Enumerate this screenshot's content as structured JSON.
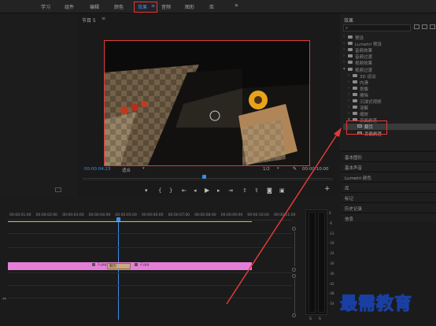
{
  "workspace_tabs": [
    "学习",
    "组件",
    "编辑",
    "颜色",
    "效果",
    "音频",
    "图形",
    "库"
  ],
  "workspace_menu_icon": "chevron-double-right-icon",
  "monitor": {
    "title": "节目 5",
    "timecode_left": "00:00:04:23",
    "fit_label": "适合",
    "quality": "1/2",
    "timecode_right": "00:00:10:00"
  },
  "effects_panel": {
    "title": "效果",
    "tree": [
      {
        "label": "预设",
        "level": 0,
        "open": false
      },
      {
        "label": "Lumetri 预设",
        "level": 0,
        "open": false
      },
      {
        "label": "音频效果",
        "level": 0,
        "open": false
      },
      {
        "label": "音频过渡",
        "level": 0,
        "open": false
      },
      {
        "label": "视频效果",
        "level": 0,
        "open": false
      },
      {
        "label": "视频过渡",
        "level": 0,
        "open": true
      },
      {
        "label": "3D 运动",
        "level": 1,
        "open": false
      },
      {
        "label": "内滑",
        "level": 1,
        "open": false
      },
      {
        "label": "划像",
        "level": 1,
        "open": false
      },
      {
        "label": "擦除",
        "level": 1,
        "open": false
      },
      {
        "label": "沉浸式视频",
        "level": 1,
        "open": false
      },
      {
        "label": "溶解",
        "level": 1,
        "open": false
      },
      {
        "label": "缩放",
        "level": 1,
        "open": false
      },
      {
        "label": "页面剥落",
        "level": 1,
        "open": true
      },
      {
        "label": "翻页",
        "level": 2,
        "open": false
      },
      {
        "label": "页面剥落",
        "level": 2,
        "open": false
      }
    ],
    "sections": [
      "基本图形",
      "基本声音",
      "Lumetri 颜色",
      "库",
      "标记",
      "历史记录",
      "信息"
    ]
  },
  "timeline": {
    "ruler": [
      "00:00:01:00",
      "00:00:02:00",
      "00:00:03:00",
      "00:00:04:00",
      "00:00:05:00",
      "00:00:06:00",
      "00:00:07:00",
      "00:00:08:00",
      "00:00:09:00",
      "00:00:10:00",
      "00:00:11:00"
    ],
    "clip_a": "1.jpg",
    "transition": "翻页",
    "clip_b": "2.jpg"
  },
  "audio_meter": {
    "db_labels": [
      "0",
      "-6",
      "-12",
      "-18",
      "-24",
      "-30",
      "-36",
      "-42",
      "-48",
      "-54"
    ],
    "channels": [
      "S",
      "S"
    ]
  },
  "watermark": "最需教育",
  "colors": {
    "accent_blue": "#3a8ee6",
    "highlight_red": "#e03a3a",
    "clip_pink": "#e47ed8",
    "transition_tan": "#c9a882"
  }
}
